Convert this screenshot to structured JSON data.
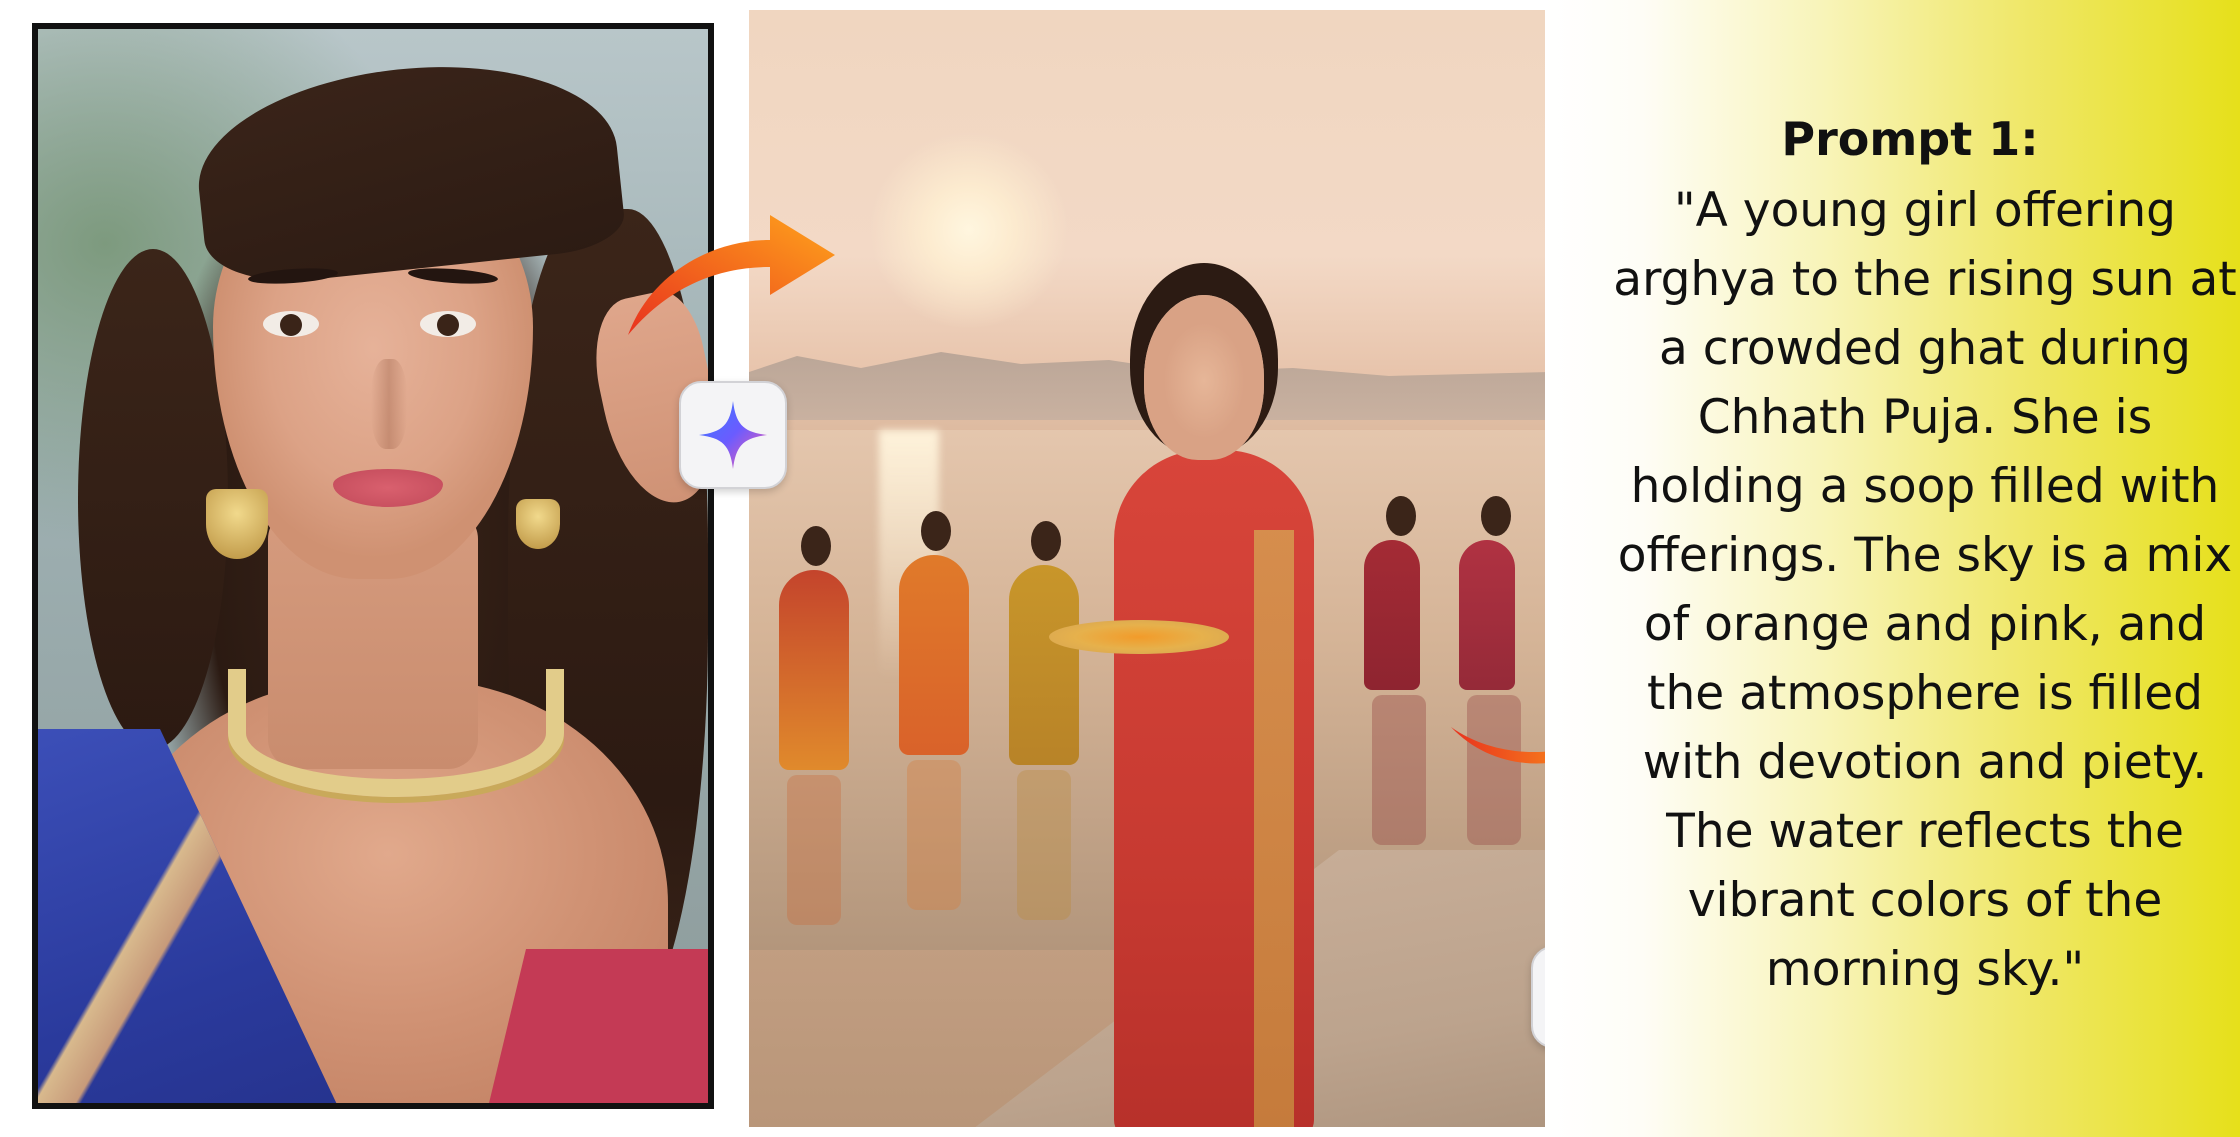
{
  "prompt": {
    "title": "Prompt 1:",
    "lines": [
      "\"A young girl offering",
      "arghya to the rising sun at",
      "a crowded ghat during",
      "Chhath Puja. She is",
      "holding a soop filled with",
      "offerings. The sky is a mix",
      "of orange and pink, and",
      "the atmosphere is filled",
      "with devotion and piety.",
      "The water reflects the",
      "vibrant colors of the",
      "morning sky.\""
    ]
  },
  "icons": {
    "badge_top": "sparkle-icon",
    "badge_bottom": "sparkle-icon",
    "arrow_top": "curved-arrow-icon",
    "arrow_right": "curved-arrow-icon"
  },
  "colors": {
    "arrow_start": "#e8321e",
    "arrow_end": "#ffa41b",
    "sparkle_blue": "#3a7bff",
    "sparkle_pink": "#ff5ea8",
    "panel_yellow": "#e6e01a"
  }
}
